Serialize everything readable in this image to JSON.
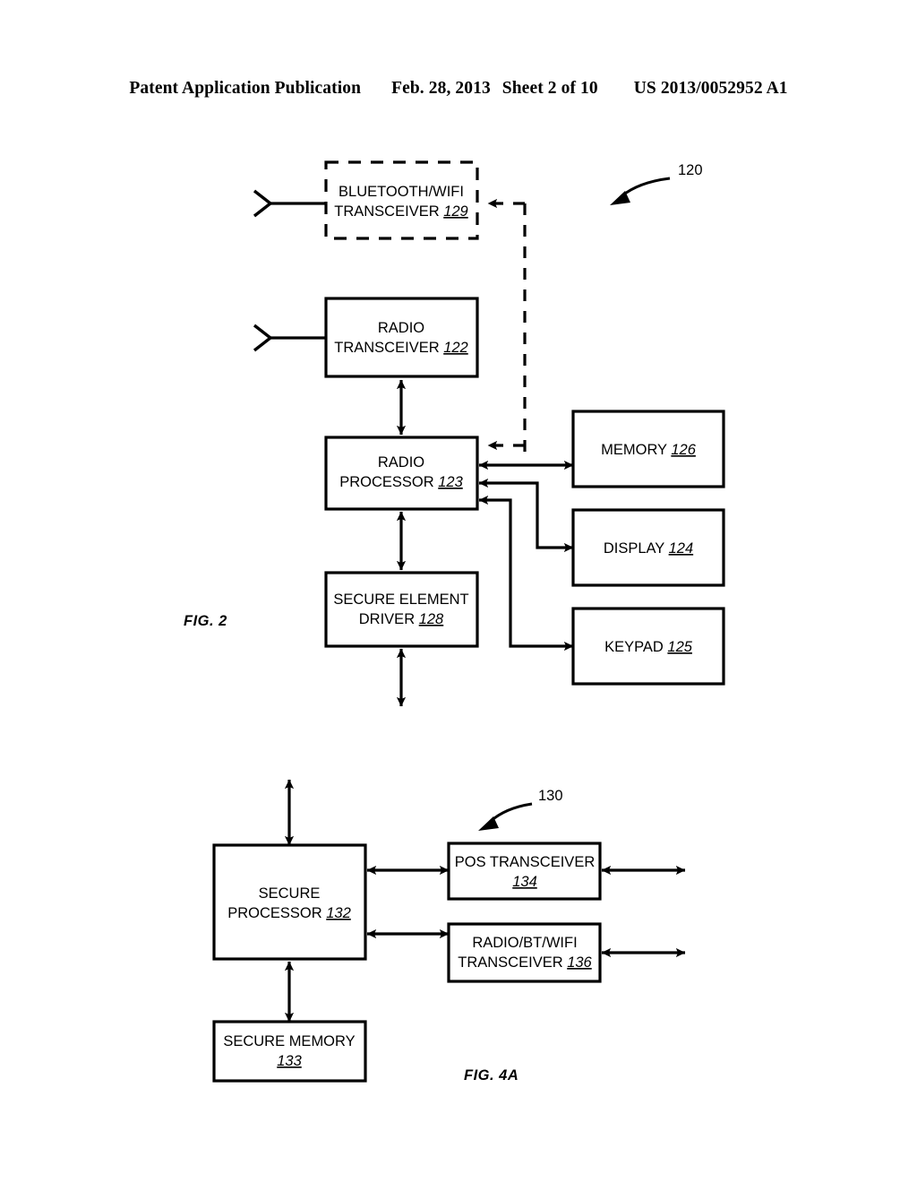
{
  "header": {
    "publication": "Patent Application Publication",
    "date": "Feb. 28, 2013",
    "sheet": "Sheet 2 of 10",
    "document_number": "US 2013/0052952 A1"
  },
  "figure_2": {
    "label": "FIG. 2",
    "reference_numeral": "120",
    "blocks": {
      "bluetooth_wifi_transceiver": {
        "line1": "BLUETOOTH/WIFI",
        "line2": "TRANSCEIVER ",
        "ref": "129",
        "border": "dashed"
      },
      "radio_transceiver": {
        "line1": "RADIO",
        "line2": "TRANSCEIVER ",
        "ref": "122",
        "border": "solid"
      },
      "radio_processor": {
        "line1": "RADIO",
        "line2": "PROCESSOR ",
        "ref": "123",
        "border": "solid"
      },
      "secure_element_driver": {
        "line1": "SECURE ELEMENT",
        "line2": "DRIVER ",
        "ref": "128",
        "border": "solid"
      },
      "memory": {
        "line1": "MEMORY ",
        "ref": "126",
        "border": "solid"
      },
      "display": {
        "line1": "DISPLAY ",
        "ref": "124",
        "border": "solid"
      },
      "keypad": {
        "line1": "KEYPAD ",
        "ref": "125",
        "border": "solid"
      }
    }
  },
  "figure_4a": {
    "label": "FIG. 4A",
    "reference_numeral": "130",
    "blocks": {
      "secure_processor": {
        "line1": "SECURE",
        "line2": "PROCESSOR ",
        "ref": "132",
        "border": "solid"
      },
      "pos_transceiver": {
        "line1": "POS TRANSCEIVER",
        "ref": "134",
        "border": "solid"
      },
      "radio_bt_wifi_transceiver": {
        "line1": "RADIO/BT/WIFI",
        "line2": "TRANSCEIVER ",
        "ref": "136",
        "border": "solid"
      },
      "secure_memory": {
        "line1": "SECURE MEMORY",
        "ref": "133",
        "border": "solid"
      }
    }
  }
}
